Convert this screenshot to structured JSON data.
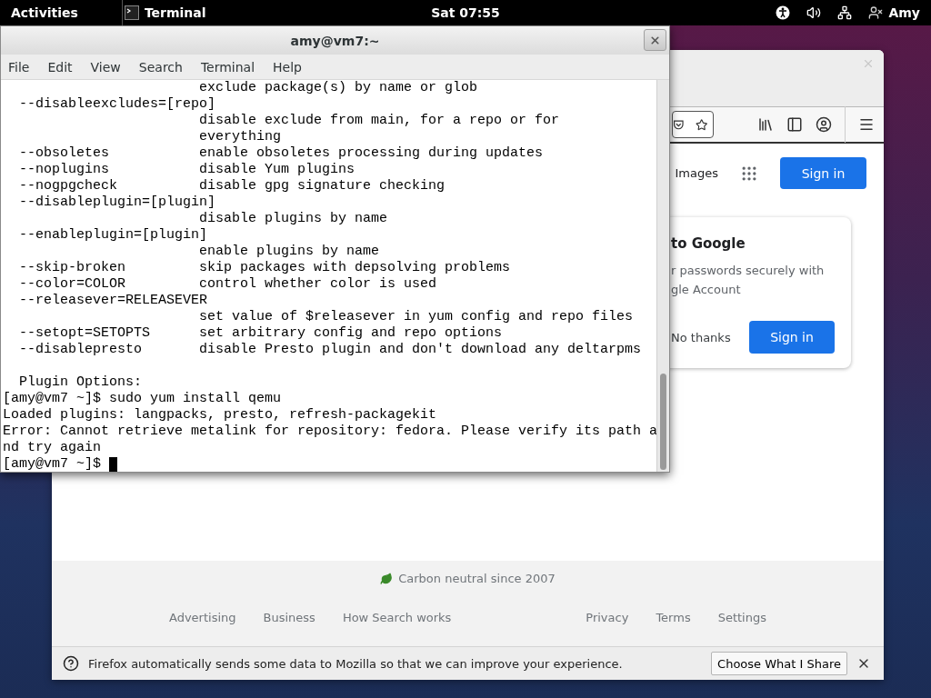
{
  "top_bar": {
    "activities": "Activities",
    "app_menu": "Terminal",
    "clock": "Sat 07:55",
    "user": "Amy"
  },
  "terminal": {
    "title": "amy@vm7:~",
    "menu": [
      "File",
      "Edit",
      "View",
      "Search",
      "Terminal",
      "Help"
    ],
    "lines": [
      {
        "text": "                        exclude package(s) by name or glob"
      },
      {
        "text": "  --disableexcludes=[repo]"
      },
      {
        "text": "                        disable exclude from main, for a repo or for"
      },
      {
        "text": "                        everything"
      },
      {
        "text": "  --obsoletes           enable obsoletes processing during updates"
      },
      {
        "text": "  --noplugins           disable Yum plugins"
      },
      {
        "text": "  --nogpgcheck          disable gpg signature checking"
      },
      {
        "text": "  --disableplugin=[plugin]"
      },
      {
        "text": "                        disable plugins by name"
      },
      {
        "text": "  --enableplugin=[plugin]"
      },
      {
        "text": "                        enable plugins by name"
      },
      {
        "text": "  --skip-broken         skip packages with depsolving problems"
      },
      {
        "text": "  --color=COLOR         control whether color is used"
      },
      {
        "text": "  --releasever=RELEASEVER"
      },
      {
        "text": "                        set value of $releasever in yum config and repo files"
      },
      {
        "text": "  --setopt=SETOPTS      set arbitrary config and repo options"
      },
      {
        "text": "  --disablepresto       disable Presto plugin and don't download any deltarpms"
      },
      {
        "text": "  Plugin Options:",
        "blank_before": true
      },
      {
        "text": "[amy@vm7 ~]$ sudo yum install qemu"
      },
      {
        "text": "Loaded plugins: langpacks, presto, refresh-packagekit"
      },
      {
        "text": "Error: Cannot retrieve metalink for repository: fedora. Please verify its path a"
      },
      {
        "text": "nd try again"
      }
    ],
    "prompt": {
      "text": "[amy@vm7 ~]$",
      "cursor": true
    }
  },
  "browser": {
    "header": {
      "images_link": "Images",
      "sign_in": "Sign in"
    },
    "sign_in_card": {
      "title": "to Google",
      "body": [
        "r passwords securely with",
        "gle Account"
      ],
      "dismiss": "No thanks",
      "sign_in": "Sign in"
    },
    "footer": {
      "carbon": "Carbon neutral since 2007",
      "links_left": [
        "Advertising",
        "Business",
        "How Search works"
      ],
      "links_right": [
        "Privacy",
        "Terms",
        "Settings"
      ]
    },
    "notification": {
      "message": "Firefox automatically sends some data to Mozilla so that we can improve your experience.",
      "button": "Choose What I Share"
    }
  }
}
